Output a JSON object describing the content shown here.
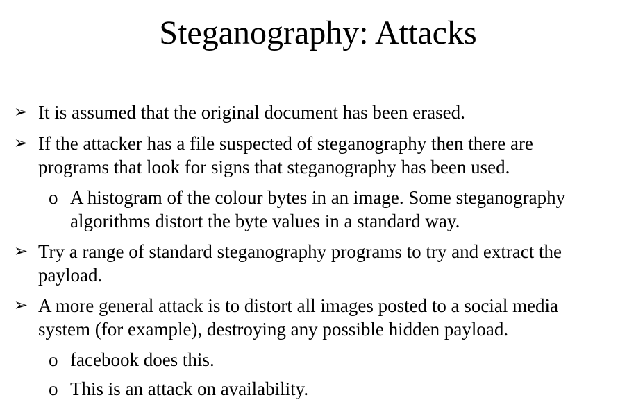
{
  "slide": {
    "title": "Steganography: Attacks",
    "bullets": [
      {
        "marker": "➢",
        "lines": [
          "It is assumed that the original document has been erased."
        ]
      },
      {
        "marker": "➢",
        "lines": [
          "If the attacker has a file suspected of steganography then there are",
          "programs that look for signs that steganography has been used."
        ]
      },
      {
        "marker": "o",
        "lines": [
          "A histogram of the colour bytes in an image.  Some steganography",
          "algorithms distort the byte values in a standard way."
        ]
      },
      {
        "marker": "➢",
        "lines": [
          "Try a range of standard steganography programs to try and extract the",
          "payload."
        ]
      },
      {
        "marker": "➢",
        "lines": [
          "A more general attack is to distort all images posted to a social media",
          "system (for example), destroying any possible hidden payload."
        ]
      },
      {
        "marker": "o",
        "lines": [
          "facebook does this."
        ]
      },
      {
        "marker": "o",
        "lines": [
          "This is an attack on availability."
        ]
      }
    ]
  }
}
